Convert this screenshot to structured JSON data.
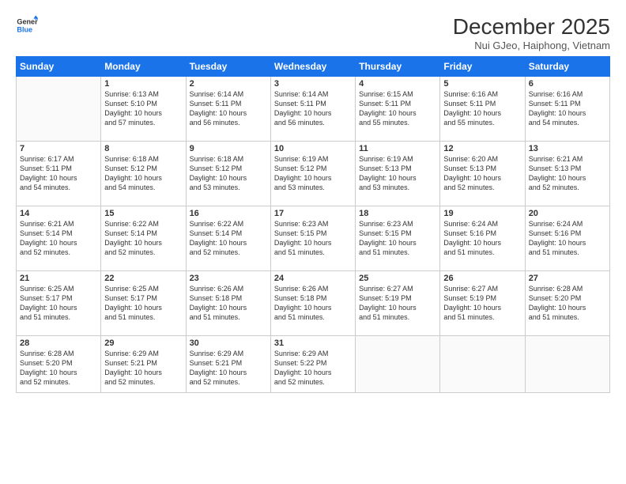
{
  "header": {
    "logo_line1": "General",
    "logo_line2": "Blue",
    "title": "December 2025",
    "subtitle": "Nui GJeo, Haiphong, Vietnam"
  },
  "weekdays": [
    "Sunday",
    "Monday",
    "Tuesday",
    "Wednesday",
    "Thursday",
    "Friday",
    "Saturday"
  ],
  "weeks": [
    [
      {
        "day": "",
        "lines": []
      },
      {
        "day": "1",
        "lines": [
          "Sunrise: 6:13 AM",
          "Sunset: 5:10 PM",
          "Daylight: 10 hours",
          "and 57 minutes."
        ]
      },
      {
        "day": "2",
        "lines": [
          "Sunrise: 6:14 AM",
          "Sunset: 5:11 PM",
          "Daylight: 10 hours",
          "and 56 minutes."
        ]
      },
      {
        "day": "3",
        "lines": [
          "Sunrise: 6:14 AM",
          "Sunset: 5:11 PM",
          "Daylight: 10 hours",
          "and 56 minutes."
        ]
      },
      {
        "day": "4",
        "lines": [
          "Sunrise: 6:15 AM",
          "Sunset: 5:11 PM",
          "Daylight: 10 hours",
          "and 55 minutes."
        ]
      },
      {
        "day": "5",
        "lines": [
          "Sunrise: 6:16 AM",
          "Sunset: 5:11 PM",
          "Daylight: 10 hours",
          "and 55 minutes."
        ]
      },
      {
        "day": "6",
        "lines": [
          "Sunrise: 6:16 AM",
          "Sunset: 5:11 PM",
          "Daylight: 10 hours",
          "and 54 minutes."
        ]
      }
    ],
    [
      {
        "day": "7",
        "lines": [
          "Sunrise: 6:17 AM",
          "Sunset: 5:11 PM",
          "Daylight: 10 hours",
          "and 54 minutes."
        ]
      },
      {
        "day": "8",
        "lines": [
          "Sunrise: 6:18 AM",
          "Sunset: 5:12 PM",
          "Daylight: 10 hours",
          "and 54 minutes."
        ]
      },
      {
        "day": "9",
        "lines": [
          "Sunrise: 6:18 AM",
          "Sunset: 5:12 PM",
          "Daylight: 10 hours",
          "and 53 minutes."
        ]
      },
      {
        "day": "10",
        "lines": [
          "Sunrise: 6:19 AM",
          "Sunset: 5:12 PM",
          "Daylight: 10 hours",
          "and 53 minutes."
        ]
      },
      {
        "day": "11",
        "lines": [
          "Sunrise: 6:19 AM",
          "Sunset: 5:13 PM",
          "Daylight: 10 hours",
          "and 53 minutes."
        ]
      },
      {
        "day": "12",
        "lines": [
          "Sunrise: 6:20 AM",
          "Sunset: 5:13 PM",
          "Daylight: 10 hours",
          "and 52 minutes."
        ]
      },
      {
        "day": "13",
        "lines": [
          "Sunrise: 6:21 AM",
          "Sunset: 5:13 PM",
          "Daylight: 10 hours",
          "and 52 minutes."
        ]
      }
    ],
    [
      {
        "day": "14",
        "lines": [
          "Sunrise: 6:21 AM",
          "Sunset: 5:14 PM",
          "Daylight: 10 hours",
          "and 52 minutes."
        ]
      },
      {
        "day": "15",
        "lines": [
          "Sunrise: 6:22 AM",
          "Sunset: 5:14 PM",
          "Daylight: 10 hours",
          "and 52 minutes."
        ]
      },
      {
        "day": "16",
        "lines": [
          "Sunrise: 6:22 AM",
          "Sunset: 5:14 PM",
          "Daylight: 10 hours",
          "and 52 minutes."
        ]
      },
      {
        "day": "17",
        "lines": [
          "Sunrise: 6:23 AM",
          "Sunset: 5:15 PM",
          "Daylight: 10 hours",
          "and 51 minutes."
        ]
      },
      {
        "day": "18",
        "lines": [
          "Sunrise: 6:23 AM",
          "Sunset: 5:15 PM",
          "Daylight: 10 hours",
          "and 51 minutes."
        ]
      },
      {
        "day": "19",
        "lines": [
          "Sunrise: 6:24 AM",
          "Sunset: 5:16 PM",
          "Daylight: 10 hours",
          "and 51 minutes."
        ]
      },
      {
        "day": "20",
        "lines": [
          "Sunrise: 6:24 AM",
          "Sunset: 5:16 PM",
          "Daylight: 10 hours",
          "and 51 minutes."
        ]
      }
    ],
    [
      {
        "day": "21",
        "lines": [
          "Sunrise: 6:25 AM",
          "Sunset: 5:17 PM",
          "Daylight: 10 hours",
          "and 51 minutes."
        ]
      },
      {
        "day": "22",
        "lines": [
          "Sunrise: 6:25 AM",
          "Sunset: 5:17 PM",
          "Daylight: 10 hours",
          "and 51 minutes."
        ]
      },
      {
        "day": "23",
        "lines": [
          "Sunrise: 6:26 AM",
          "Sunset: 5:18 PM",
          "Daylight: 10 hours",
          "and 51 minutes."
        ]
      },
      {
        "day": "24",
        "lines": [
          "Sunrise: 6:26 AM",
          "Sunset: 5:18 PM",
          "Daylight: 10 hours",
          "and 51 minutes."
        ]
      },
      {
        "day": "25",
        "lines": [
          "Sunrise: 6:27 AM",
          "Sunset: 5:19 PM",
          "Daylight: 10 hours",
          "and 51 minutes."
        ]
      },
      {
        "day": "26",
        "lines": [
          "Sunrise: 6:27 AM",
          "Sunset: 5:19 PM",
          "Daylight: 10 hours",
          "and 51 minutes."
        ]
      },
      {
        "day": "27",
        "lines": [
          "Sunrise: 6:28 AM",
          "Sunset: 5:20 PM",
          "Daylight: 10 hours",
          "and 51 minutes."
        ]
      }
    ],
    [
      {
        "day": "28",
        "lines": [
          "Sunrise: 6:28 AM",
          "Sunset: 5:20 PM",
          "Daylight: 10 hours",
          "and 52 minutes."
        ]
      },
      {
        "day": "29",
        "lines": [
          "Sunrise: 6:29 AM",
          "Sunset: 5:21 PM",
          "Daylight: 10 hours",
          "and 52 minutes."
        ]
      },
      {
        "day": "30",
        "lines": [
          "Sunrise: 6:29 AM",
          "Sunset: 5:21 PM",
          "Daylight: 10 hours",
          "and 52 minutes."
        ]
      },
      {
        "day": "31",
        "lines": [
          "Sunrise: 6:29 AM",
          "Sunset: 5:22 PM",
          "Daylight: 10 hours",
          "and 52 minutes."
        ]
      },
      {
        "day": "",
        "lines": []
      },
      {
        "day": "",
        "lines": []
      },
      {
        "day": "",
        "lines": []
      }
    ]
  ]
}
